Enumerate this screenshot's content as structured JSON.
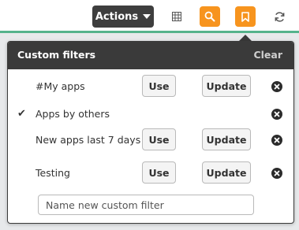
{
  "toolbar": {
    "actions_label": "Actions",
    "icons": [
      "grid-icon",
      "search-icon",
      "bookmark-icon",
      "refresh-icon"
    ],
    "accent_color": "#f7941e",
    "underline_color": "#55b38c"
  },
  "panel": {
    "title": "Custom filters",
    "clear_label": "Clear",
    "header_color": "#3a3a3a",
    "filters": [
      {
        "name": "#My apps",
        "selected": false,
        "use_label": "Use",
        "update_label": "Update"
      },
      {
        "name": "Apps by others",
        "selected": true
      },
      {
        "name": "New apps last 7 days",
        "selected": false,
        "use_label": "Use",
        "update_label": "Update"
      },
      {
        "name": "Testing",
        "selected": false,
        "use_label": "Use",
        "update_label": "Update"
      }
    ],
    "new_filter_placeholder": "Name new custom filter"
  }
}
